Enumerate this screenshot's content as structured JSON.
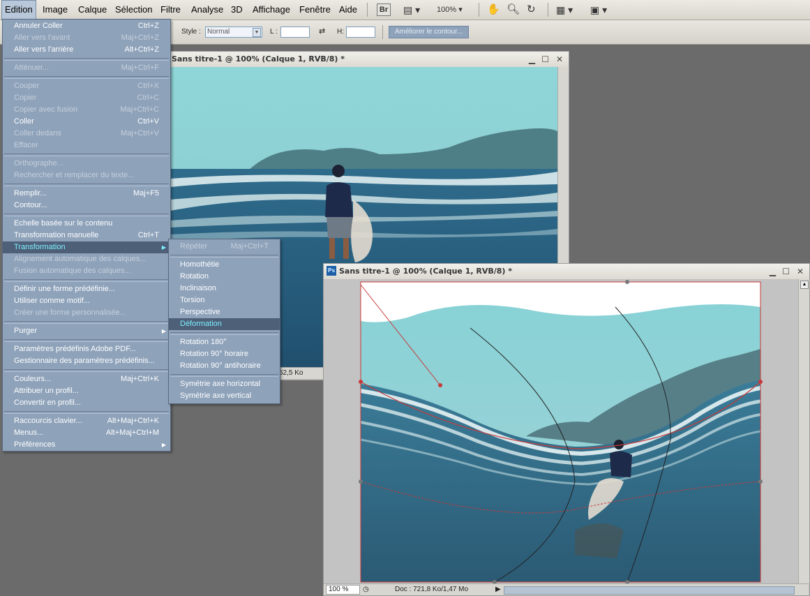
{
  "menubar": {
    "items": [
      "Edition",
      "Image",
      "Calque",
      "Sélection",
      "Filtre",
      "Analyse",
      "3D",
      "Affichage",
      "Fenêtre",
      "Aide"
    ],
    "toolbar": {
      "br": "Br",
      "zoom": "100%"
    }
  },
  "options": {
    "style_label": "Style :",
    "style_value": "Normal",
    "l_label": "L :",
    "h_label": "H:",
    "refine_button": "Améliorer le contour..."
  },
  "window1": {
    "title": "Sans titre-1 @ 100% (Calque 1, RVB/8) *",
    "status": "52,5 Ko"
  },
  "window2": {
    "title": "Sans titre-1 @ 100% (Calque 1, RVB/8) *",
    "zoom": "100 %",
    "doc": "Doc : 721,8 Ko/1,47 Mo"
  },
  "edit_menu": [
    {
      "label": "Annuler Coller",
      "shortcut": "Ctrl+Z",
      "disabled": false
    },
    {
      "label": "Aller vers l'avant",
      "shortcut": "Maj+Ctrl+Z",
      "disabled": true
    },
    {
      "label": "Aller vers l'arrière",
      "shortcut": "Alt+Ctrl+Z",
      "disabled": false
    },
    {
      "sep": true
    },
    {
      "label": "Atténuer...",
      "shortcut": "Maj+Ctrl+F",
      "disabled": true
    },
    {
      "sep": true
    },
    {
      "label": "Couper",
      "shortcut": "Ctrl+X",
      "disabled": true
    },
    {
      "label": "Copier",
      "shortcut": "Ctrl+C",
      "disabled": true
    },
    {
      "label": "Copier avec fusion",
      "shortcut": "Maj+Ctrl+C",
      "disabled": true
    },
    {
      "label": "Coller",
      "shortcut": "Ctrl+V",
      "disabled": false
    },
    {
      "label": "Coller dedans",
      "shortcut": "Maj+Ctrl+V",
      "disabled": true
    },
    {
      "label": "Effacer",
      "shortcut": "",
      "disabled": true
    },
    {
      "sep": true
    },
    {
      "label": "Orthographe...",
      "shortcut": "",
      "disabled": true
    },
    {
      "label": "Rechercher et remplacer du texte...",
      "shortcut": "",
      "disabled": true
    },
    {
      "sep": true
    },
    {
      "label": "Remplir...",
      "shortcut": "Maj+F5",
      "disabled": false
    },
    {
      "label": "Contour...",
      "shortcut": "",
      "disabled": false
    },
    {
      "sep": true
    },
    {
      "label": "Echelle basée sur le contenu",
      "shortcut": "",
      "disabled": false
    },
    {
      "label": "Transformation manuelle",
      "shortcut": "Ctrl+T",
      "disabled": false
    },
    {
      "label": "Transformation",
      "shortcut": "",
      "disabled": false,
      "highlight": true,
      "submenu": true
    },
    {
      "label": "Alignement automatique des calques...",
      "shortcut": "",
      "disabled": true
    },
    {
      "label": "Fusion automatique des calques...",
      "shortcut": "",
      "disabled": true
    },
    {
      "sep": true
    },
    {
      "label": "Définir une forme prédéfinie...",
      "shortcut": "",
      "disabled": false
    },
    {
      "label": "Utiliser comme motif...",
      "shortcut": "",
      "disabled": false
    },
    {
      "label": "Créer une forme personnalisée...",
      "shortcut": "",
      "disabled": true
    },
    {
      "sep": true
    },
    {
      "label": "Purger",
      "shortcut": "",
      "disabled": false,
      "submenu": true
    },
    {
      "sep": true
    },
    {
      "label": "Paramètres prédéfinis Adobe PDF...",
      "shortcut": "",
      "disabled": false
    },
    {
      "label": "Gestionnaire des paramètres prédéfinis...",
      "shortcut": "",
      "disabled": false
    },
    {
      "sep": true
    },
    {
      "label": "Couleurs...",
      "shortcut": "Maj+Ctrl+K",
      "disabled": false
    },
    {
      "label": "Attribuer un profil...",
      "shortcut": "",
      "disabled": false
    },
    {
      "label": "Convertir en profil...",
      "shortcut": "",
      "disabled": false
    },
    {
      "sep": true
    },
    {
      "label": "Raccourcis clavier...",
      "shortcut": "Alt+Maj+Ctrl+K",
      "disabled": false
    },
    {
      "label": "Menus...",
      "shortcut": "Alt+Maj+Ctrl+M",
      "disabled": false
    },
    {
      "label": "Préférences",
      "shortcut": "",
      "disabled": false,
      "submenu": true
    }
  ],
  "transform_submenu": [
    {
      "label": "Répéter",
      "shortcut": "Maj+Ctrl+T",
      "disabled": true
    },
    {
      "sep": true
    },
    {
      "label": "Homothétie",
      "shortcut": "",
      "disabled": false
    },
    {
      "label": "Rotation",
      "shortcut": "",
      "disabled": false
    },
    {
      "label": "Inclinaison",
      "shortcut": "",
      "disabled": false
    },
    {
      "label": "Torsion",
      "shortcut": "",
      "disabled": false
    },
    {
      "label": "Perspective",
      "shortcut": "",
      "disabled": false
    },
    {
      "label": "Déformation",
      "shortcut": "",
      "disabled": false,
      "highlight": true
    },
    {
      "sep": true
    },
    {
      "label": "Rotation 180°",
      "shortcut": "",
      "disabled": false
    },
    {
      "label": "Rotation 90° horaire",
      "shortcut": "",
      "disabled": false
    },
    {
      "label": "Rotation 90° antihoraire",
      "shortcut": "",
      "disabled": false
    },
    {
      "sep": true
    },
    {
      "label": "Symétrie axe horizontal",
      "shortcut": "",
      "disabled": false
    },
    {
      "label": "Symétrie axe vertical",
      "shortcut": "",
      "disabled": false
    }
  ],
  "colors": {
    "menu_bg": "#8ea2ba",
    "menu_highlight": "#4e5f78",
    "highlight_text": "#7ef0ff",
    "workspace": "#6b6b6b"
  }
}
